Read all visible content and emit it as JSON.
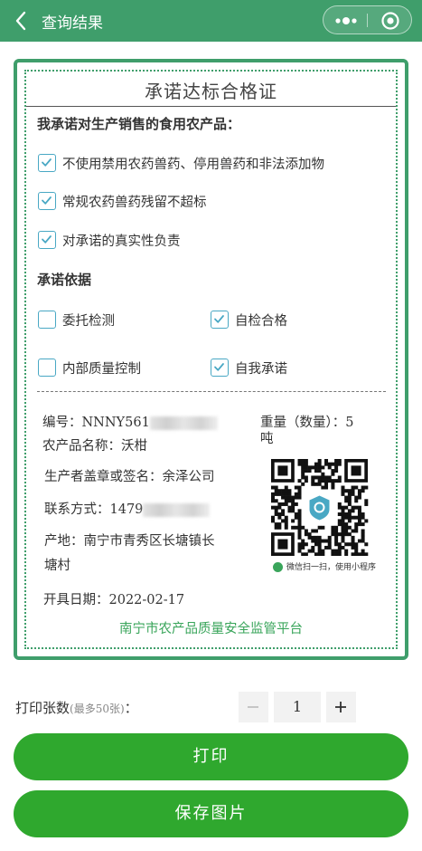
{
  "header": {
    "title": "查询结果",
    "bg_color": "#3f9e6b"
  },
  "certificate": {
    "title": "承诺达标合格证",
    "pledge_heading": "我承诺对生产销售的食用农产品：",
    "pledges": [
      {
        "label": "不使用禁用农药兽药、停用兽药和非法添加物",
        "checked": true
      },
      {
        "label": "常规农药兽药残留不超标",
        "checked": true
      },
      {
        "label": "对承诺的真实性负责",
        "checked": true
      }
    ],
    "basis_heading": "承诺依据",
    "basis": [
      {
        "label": "委托检测",
        "checked": false
      },
      {
        "label": "自检合格",
        "checked": true
      },
      {
        "label": "内部质量控制",
        "checked": false
      },
      {
        "label": "自我承诺",
        "checked": true
      }
    ],
    "info": {
      "number": "编号：NNNY561",
      "weight_line1": "重量（数量）：5",
      "weight_line2": "吨",
      "product": "农产品名称：沃柑",
      "producer": "生产者盖章或签名：余泽公司",
      "contact": "联系方式：1479",
      "origin_line1": "产地：南宁市青秀区长塘镇长",
      "origin_line2": "塘村",
      "issue_date": "开具日期：2022-02-17"
    },
    "qr_caption": "微信扫一扫，使用小程序",
    "platform": "南宁市农产品质量安全监管平台",
    "accent_color": "#3f9e6b"
  },
  "print": {
    "count_label": "打印张数",
    "count_hint": "(最多50张)",
    "count_colon": "：",
    "count_value": "1",
    "print_button": "打印",
    "save_button": "保存图片",
    "button_color": "#2fa82e"
  }
}
